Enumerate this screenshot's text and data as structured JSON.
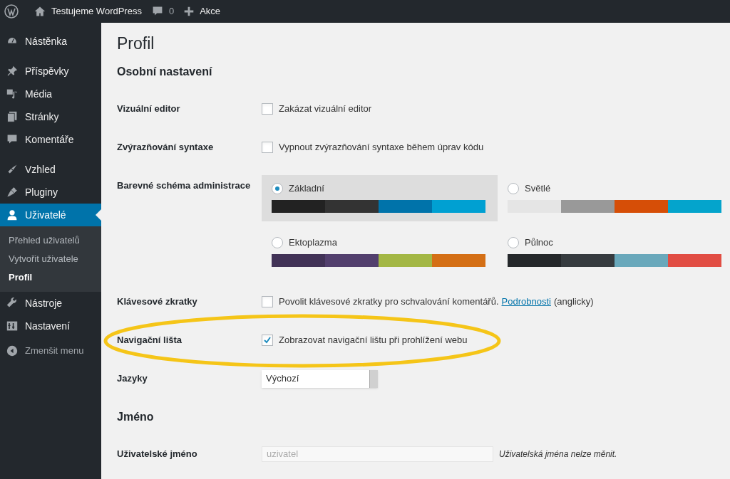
{
  "top_bar": {
    "site_name": "Testujeme WordPress",
    "comments_count": "0",
    "new_label": "Akce"
  },
  "sidebar": {
    "groups": [
      [
        {
          "label": "Nástěnka",
          "selected": false
        }
      ],
      [
        {
          "label": "Příspěvky",
          "selected": false
        },
        {
          "label": "Média",
          "selected": false
        },
        {
          "label": "Stránky",
          "selected": false
        },
        {
          "label": "Komentáře",
          "selected": false
        }
      ],
      [
        {
          "label": "Vzhled",
          "selected": false
        },
        {
          "label": "Pluginy",
          "selected": false
        },
        {
          "label": "Uživatelé",
          "selected": true,
          "children": [
            {
              "label": "Přehled uživatelů",
              "selected": false
            },
            {
              "label": "Vytvořit uživatele",
              "selected": false
            },
            {
              "label": "Profil",
              "selected": true
            }
          ]
        },
        {
          "label": "Nástroje",
          "selected": false
        },
        {
          "label": "Nastavení",
          "selected": false
        }
      ]
    ],
    "collapse_label": "Zmenšit menu"
  },
  "page": {
    "title": "Profil",
    "sections": [
      {
        "heading": "Osobní nastavení",
        "rows": [
          {
            "kind": "checkbox",
            "label": "Vizuální editor",
            "text": "Zakázat vizuální editor",
            "checked": false
          },
          {
            "kind": "checkbox",
            "label": "Zvýrazňování syntaxe",
            "text": "Vypnout zvýrazňování syntaxe během úprav kódu",
            "checked": false
          },
          {
            "kind": "schemes",
            "label": "Barevné schéma administrace",
            "schemes": [
              {
                "name": "Základní",
                "selected": true,
                "swatches": [
                  {
                    "color": "#222222"
                  },
                  {
                    "color": "#333333"
                  },
                  {
                    "color": "#0073aa"
                  },
                  {
                    "color": "#00a0d2"
                  }
                ]
              },
              {
                "name": "Světlé",
                "selected": false,
                "swatches": [
                  {
                    "color": "#e5e5e5"
                  },
                  {
                    "color": "#999999"
                  },
                  {
                    "color": "#d64e07"
                  },
                  {
                    "color": "#04a4cc"
                  }
                ]
              },
              {
                "name": "Ektoplazma",
                "selected": false,
                "swatches": [
                  {
                    "color": "#413256"
                  },
                  {
                    "color": "#523f6d"
                  },
                  {
                    "color": "#a3b745"
                  },
                  {
                    "color": "#d46f15"
                  }
                ]
              },
              {
                "name": "Půlnoc",
                "selected": false,
                "swatches": [
                  {
                    "color": "#25282b"
                  },
                  {
                    "color": "#363b3f"
                  },
                  {
                    "color": "#69a8bb"
                  },
                  {
                    "color": "#e14d43"
                  }
                ]
              }
            ]
          },
          {
            "kind": "checkbox",
            "label": "Klávesové zkratky",
            "text": "Povolit klávesové zkratky pro schvalování komentářů.",
            "link": "Podrobnosti",
            "suffix": "(anglicky)",
            "checked": false
          },
          {
            "kind": "checkbox",
            "label": "Navigační lišta",
            "text": "Zobrazovat navigační lištu při prohlížení webu",
            "checked": true,
            "highlighted": true
          },
          {
            "kind": "select",
            "label": "Jazyky",
            "value": "Výchozí"
          }
        ]
      },
      {
        "heading": "Jméno",
        "rows": [
          {
            "kind": "readonly",
            "label": "Uživatelské jméno",
            "value": "uzivatel",
            "note": "Uživatelská jména nelze měnit."
          }
        ]
      }
    ]
  }
}
